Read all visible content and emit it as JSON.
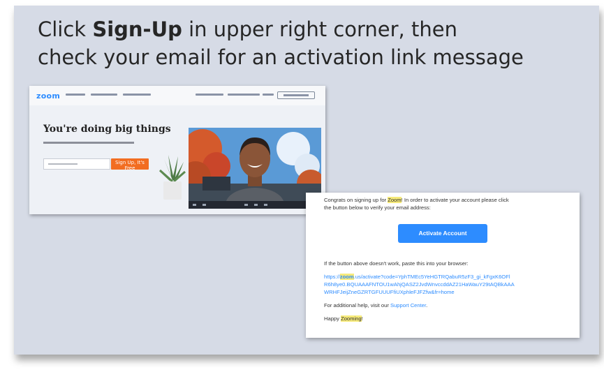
{
  "slide": {
    "title_before": "Click ",
    "title_bold": "Sign-Up",
    "title_after": " in upper right corner, then",
    "title_line2": "check your email for an activation link message"
  },
  "zoom_page": {
    "logo": "zoom",
    "hero_heading": "You're doing big things",
    "cta_label": "Sign Up, It's Free"
  },
  "email": {
    "line1_a": "Congrats on signing up for ",
    "line1_highlight": "Zoom",
    "line1_b": "! In order to activate your account please click",
    "line2": "the button below to verify your email address:",
    "button_label": "Activate Account",
    "fallback_text": "If the button above doesn't work, paste this into your browser:",
    "link_prefix": "https://",
    "link_highlight": "zoom",
    "link_line1_rest": ".us/activate?code=YphTMEc5YeHGTRQabuR5zF3_gi_kFgxK6OFl",
    "link_line2": "R6h8ye0.BQUAAAFNTOU1wAhjQASZ2JvdWnvccddAZ21HaWauY29tAQBkAAA",
    "link_line3": "WRHFJeijZneGZRTGFUUUFfiUXphleFJFZfw&fr=home",
    "help_prefix": "For additional help, visit our ",
    "help_link": "Support Center",
    "help_suffix": ".",
    "signoff_a": "Happy ",
    "signoff_highlight": "Zooming",
    "signoff_b": "!"
  },
  "colors": {
    "slide_background": "#d6dbe6",
    "zoom_blue": "#2d8cff",
    "cta_orange": "#f26d21",
    "highlight_yellow": "#f6ea7a"
  }
}
